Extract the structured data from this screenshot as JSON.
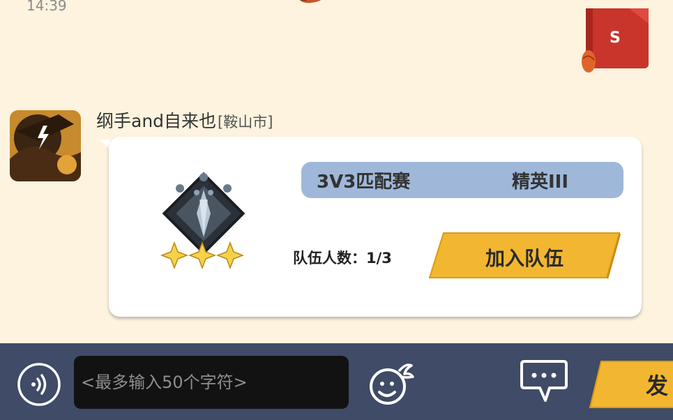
{
  "status": {
    "time": "14:39"
  },
  "self": {
    "initial": "S"
  },
  "message": {
    "sender_name": "纲手and自来也",
    "sender_region": "[鞍山市]",
    "card": {
      "mode": "3V3匹配赛",
      "rank": "精英III",
      "rank_stars": 3,
      "team_count_label": "队伍人数：1/3",
      "join_label": "加入队伍"
    }
  },
  "input_bar": {
    "placeholder": "<最多输入50个字符>",
    "value": "",
    "send_label": "发"
  },
  "colors": {
    "background": "#fdf3df",
    "accent_yellow": "#f2b630",
    "info_bar": "#9fb8d9",
    "bottom_bar": "#3f4b67"
  },
  "icons": [
    "voice-icon",
    "emoji-icon",
    "chat-bubble-icon",
    "rank-emblem-icon",
    "star-icon"
  ]
}
